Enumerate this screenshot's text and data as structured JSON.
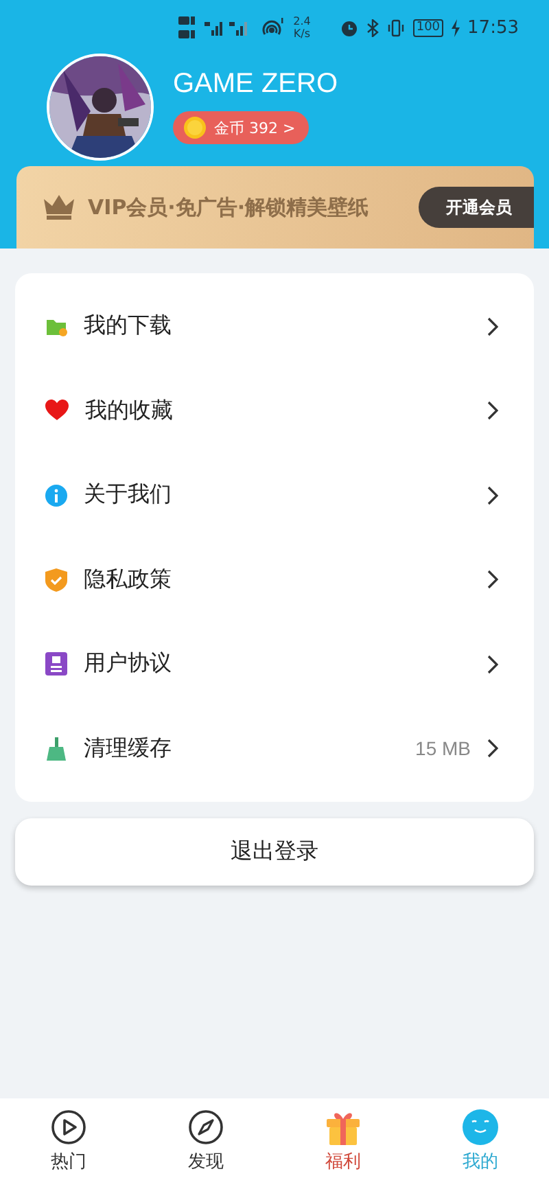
{
  "status_bar": {
    "speed": "2.4",
    "speed_unit": "K/s",
    "battery": "100",
    "time": "17:53"
  },
  "profile": {
    "name": "GAME ZERO",
    "coins": "金币 392 >"
  },
  "vip_banner": {
    "text": "VIP会员·免广告·解锁精美壁纸",
    "button": "开通会员"
  },
  "menu": [
    {
      "kind": "download",
      "label": "我的下载"
    },
    {
      "kind": "favorite",
      "label": "我的收藏"
    },
    {
      "kind": "about",
      "label": "关于我们"
    },
    {
      "kind": "privacy",
      "label": "隐私政策"
    },
    {
      "kind": "agreement",
      "label": "用户协议"
    },
    {
      "kind": "cache",
      "label": "清理缓存",
      "value": "15 MB"
    }
  ],
  "logout_button": "退出登录",
  "tabs": [
    {
      "kind": "hot",
      "label": "热门",
      "selected": false
    },
    {
      "kind": "discover",
      "label": "发现",
      "selected": false
    },
    {
      "kind": "gift",
      "label": "福利",
      "selected": false
    },
    {
      "kind": "mine",
      "label": "我的",
      "selected": true
    }
  ]
}
